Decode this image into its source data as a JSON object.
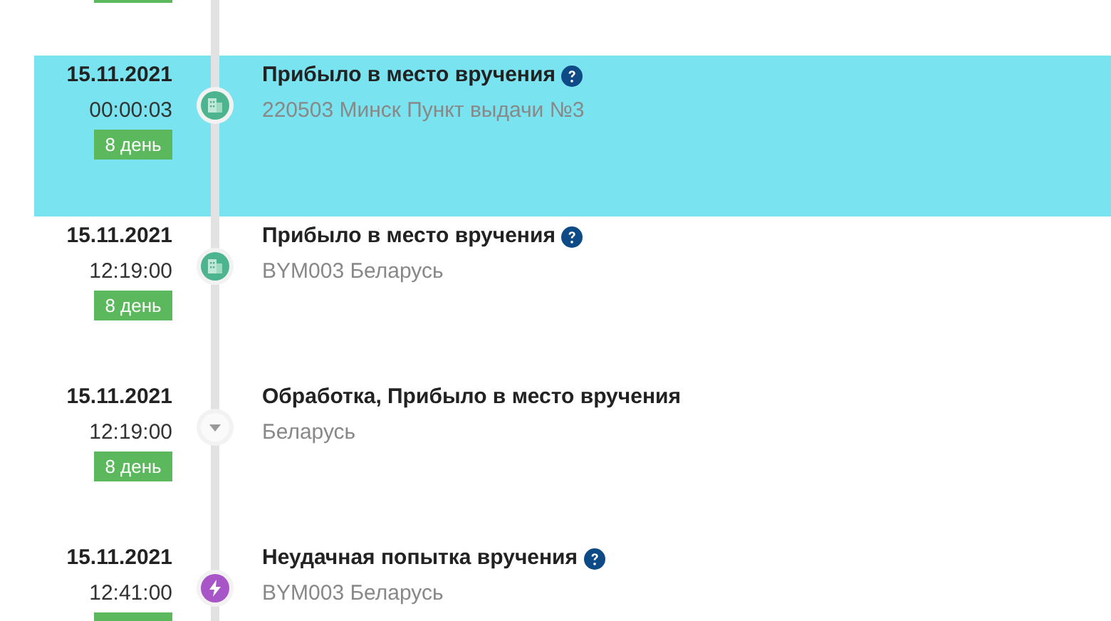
{
  "events": [
    {
      "date": "15.11.2021",
      "time": "00:00:03",
      "badge": "8 день",
      "title": "Прибыло в место вручения",
      "help": true,
      "place": "220503 Минск Пункт выдачи №3",
      "kind": "building",
      "selected": true
    },
    {
      "date": "15.11.2021",
      "time": "12:19:00",
      "badge": "8 день",
      "title": "Прибыло в место вручения",
      "help": true,
      "place": "BYM003 Беларусь",
      "kind": "building",
      "selected": false
    },
    {
      "date": "15.11.2021",
      "time": "12:19:00",
      "badge": "8 день",
      "title": "Обработка, Прибыло в место вручения",
      "help": false,
      "place": "Беларусь",
      "kind": "chevron",
      "selected": false
    },
    {
      "date": "15.11.2021",
      "time": "12:41:00",
      "title": "Неудачная попытка вручения",
      "help": true,
      "place": "BYM003 Беларусь",
      "kind": "bolt",
      "selected": false
    }
  ]
}
